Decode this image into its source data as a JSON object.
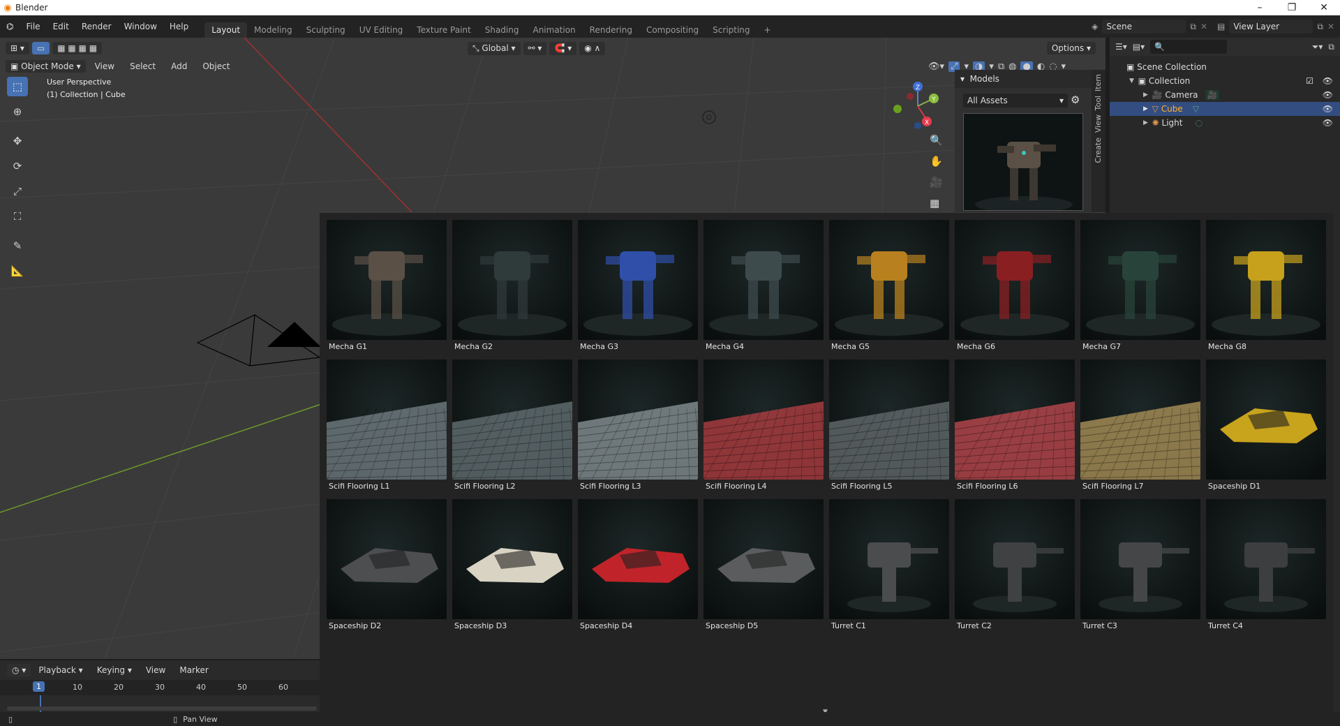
{
  "window": {
    "title": "Blender"
  },
  "menu": [
    "File",
    "Edit",
    "Render",
    "Window",
    "Help"
  ],
  "workspaces": [
    "Layout",
    "Modeling",
    "Sculpting",
    "UV Editing",
    "Texture Paint",
    "Shading",
    "Animation",
    "Rendering",
    "Compositing",
    "Scripting"
  ],
  "active_workspace": "Layout",
  "scene_name": "Scene",
  "view_layer": "View Layer",
  "viewport_header": {
    "transform_orientation": "Global",
    "options_label": "Options",
    "mode": "Object Mode",
    "menus": [
      "View",
      "Select",
      "Add",
      "Object"
    ]
  },
  "viewport_overlay": {
    "perspective": "User Perspective",
    "collection_info": "(1) Collection | Cube"
  },
  "gizmo": {
    "z": "Z",
    "y": "Y",
    "x": "X"
  },
  "npanel": {
    "section": "Models",
    "library": "All Assets",
    "tabs": [
      "Item",
      "Tool",
      "View",
      "Create"
    ]
  },
  "outliner": {
    "root": "Scene Collection",
    "collection": "Collection",
    "items": [
      {
        "name": "Camera",
        "selected": false
      },
      {
        "name": "Cube",
        "selected": true
      },
      {
        "name": "Light",
        "selected": false
      }
    ]
  },
  "assets": [
    {
      "name": "Mecha G1",
      "kind": "mech",
      "color": "#5a5046"
    },
    {
      "name": "Mecha G2",
      "kind": "mech",
      "color": "#2f3a3a"
    },
    {
      "name": "Mecha G3",
      "kind": "mech",
      "color": "#2f4fa8"
    },
    {
      "name": "Mecha G4",
      "kind": "mech",
      "color": "#3e4b4d"
    },
    {
      "name": "Mecha G5",
      "kind": "mech",
      "color": "#b8801e"
    },
    {
      "name": "Mecha G6",
      "kind": "mech",
      "color": "#8a1f22"
    },
    {
      "name": "Mecha G7",
      "kind": "mech",
      "color": "#28443a"
    },
    {
      "name": "Mecha G8",
      "kind": "mech",
      "color": "#c7a11c"
    },
    {
      "name": "Scifi Flooring L1",
      "kind": "floor",
      "color": "#6b777b"
    },
    {
      "name": "Scifi Flooring L2",
      "kind": "floor",
      "color": "#5e6a6d"
    },
    {
      "name": "Scifi Flooring L3",
      "kind": "floor",
      "color": "#7f8a8c"
    },
    {
      "name": "Scifi Flooring L4",
      "kind": "floor",
      "color": "#a63c40"
    },
    {
      "name": "Scifi Flooring L5",
      "kind": "floor",
      "color": "#5d6567"
    },
    {
      "name": "Scifi Flooring L6",
      "kind": "floor",
      "color": "#b0454a"
    },
    {
      "name": "Scifi Flooring L7",
      "kind": "floor",
      "color": "#a18a55"
    },
    {
      "name": "Spaceship D1",
      "kind": "ship",
      "color": "#c8a31c"
    },
    {
      "name": "Spaceship D2",
      "kind": "ship",
      "color": "#4d4e50"
    },
    {
      "name": "Spaceship D3",
      "kind": "ship",
      "color": "#d9d3c4"
    },
    {
      "name": "Spaceship D4",
      "kind": "ship",
      "color": "#c0242a"
    },
    {
      "name": "Spaceship D5",
      "kind": "ship",
      "color": "#5a5c5e"
    },
    {
      "name": "Turret C1",
      "kind": "turret",
      "color": "#4a4c4d"
    },
    {
      "name": "Turret C2",
      "kind": "turret",
      "color": "#3f4142"
    },
    {
      "name": "Turret C3",
      "kind": "turret",
      "color": "#444647"
    },
    {
      "name": "Turret C4",
      "kind": "turret",
      "color": "#3c3e40"
    }
  ],
  "timeline": {
    "menus": [
      "Playback",
      "Keying",
      "View",
      "Marker"
    ],
    "current_frame": "1",
    "ticks": [
      "10",
      "20",
      "30",
      "40",
      "50",
      "60"
    ]
  },
  "status": {
    "hint": "Pan View"
  },
  "colors": {
    "accent": "#4772b3",
    "selected_text": "#ffaf29"
  }
}
